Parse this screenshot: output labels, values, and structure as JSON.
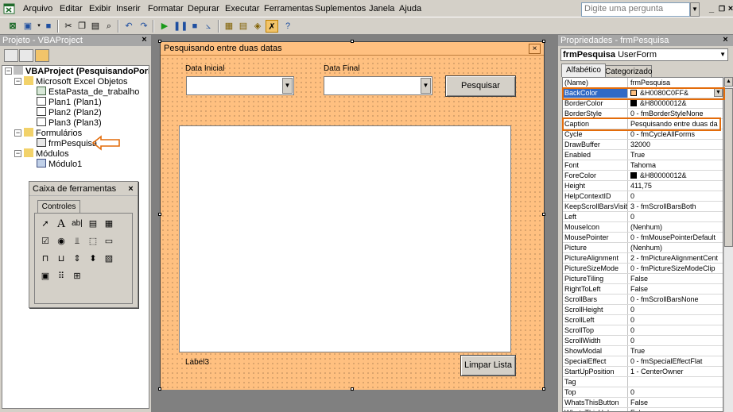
{
  "menu": [
    "Arquivo",
    "Editar",
    "Exibir",
    "Inserir",
    "Formatar",
    "Depurar",
    "Executar",
    "Ferramentas",
    "Suplementos",
    "Janela",
    "Ajuda"
  ],
  "ask_placeholder": "Digite uma pergunta",
  "project": {
    "title": "Projeto - VBAProject",
    "root": "VBAProject (PesquisandoPorDatas",
    "excel_objects": "Microsoft Excel Objetos",
    "objects": [
      "EstaPasta_de_trabalho",
      "Plan1 (Plan1)",
      "Plan2 (Plan2)",
      "Plan3 (Plan3)"
    ],
    "forms_folder": "Formulários",
    "form": "frmPesquisa",
    "modules_folder": "Módulos",
    "module": "Módulo1"
  },
  "toolbox": {
    "title": "Caixa de ferramentas",
    "tab": "Controles"
  },
  "form": {
    "caption": "Pesquisando entre duas datas",
    "label_start": "Data Inicial",
    "label_end": "Data Final",
    "search_button": "Pesquisar",
    "label3": "Label3",
    "clear_button": "Limpar Lista"
  },
  "props": {
    "title": "Propriedades - frmPesquisa",
    "object_bold": "frmPesquisa",
    "object_type": "UserForm",
    "tab_alpha": "Alfabético",
    "tab_cat": "Categorizado",
    "rows": [
      {
        "name": "(Name)",
        "value": "frmPesquisa"
      },
      {
        "name": "BackColor",
        "value": "&H0080C0FF&"
      },
      {
        "name": "BorderColor",
        "value": "&H80000012&"
      },
      {
        "name": "BorderStyle",
        "value": "0 - fmBorderStyleNone"
      },
      {
        "name": "Caption",
        "value": "Pesquisando entre duas da"
      },
      {
        "name": "Cycle",
        "value": "0 - fmCycleAllForms"
      },
      {
        "name": "DrawBuffer",
        "value": "32000"
      },
      {
        "name": "Enabled",
        "value": "True"
      },
      {
        "name": "Font",
        "value": "Tahoma"
      },
      {
        "name": "ForeColor",
        "value": "&H80000012&"
      },
      {
        "name": "Height",
        "value": "411,75"
      },
      {
        "name": "HelpContextID",
        "value": "0"
      },
      {
        "name": "KeepScrollBarsVisible",
        "value": "3 - fmScrollBarsBoth"
      },
      {
        "name": "Left",
        "value": "0"
      },
      {
        "name": "MouseIcon",
        "value": "(Nenhum)"
      },
      {
        "name": "MousePointer",
        "value": "0 - fmMousePointerDefault"
      },
      {
        "name": "Picture",
        "value": "(Nenhum)"
      },
      {
        "name": "PictureAlignment",
        "value": "2 - fmPictureAlignmentCent"
      },
      {
        "name": "PictureSizeMode",
        "value": "0 - fmPictureSizeModeClip"
      },
      {
        "name": "PictureTiling",
        "value": "False"
      },
      {
        "name": "RightToLeft",
        "value": "False"
      },
      {
        "name": "ScrollBars",
        "value": "0 - fmScrollBarsNone"
      },
      {
        "name": "ScrollHeight",
        "value": "0"
      },
      {
        "name": "ScrollLeft",
        "value": "0"
      },
      {
        "name": "ScrollTop",
        "value": "0"
      },
      {
        "name": "ScrollWidth",
        "value": "0"
      },
      {
        "name": "ShowModal",
        "value": "True"
      },
      {
        "name": "SpecialEffect",
        "value": "0 - fmSpecialEffectFlat"
      },
      {
        "name": "StartUpPosition",
        "value": "1 - CenterOwner"
      },
      {
        "name": "Tag",
        "value": ""
      },
      {
        "name": "Top",
        "value": "0"
      },
      {
        "name": "WhatsThisButton",
        "value": "False"
      },
      {
        "name": "WhatsThisHelp",
        "value": "False"
      }
    ]
  },
  "colors": {
    "form_back": "#ffc080",
    "highlight": "#e36c0a",
    "selection": "#316ac5"
  }
}
